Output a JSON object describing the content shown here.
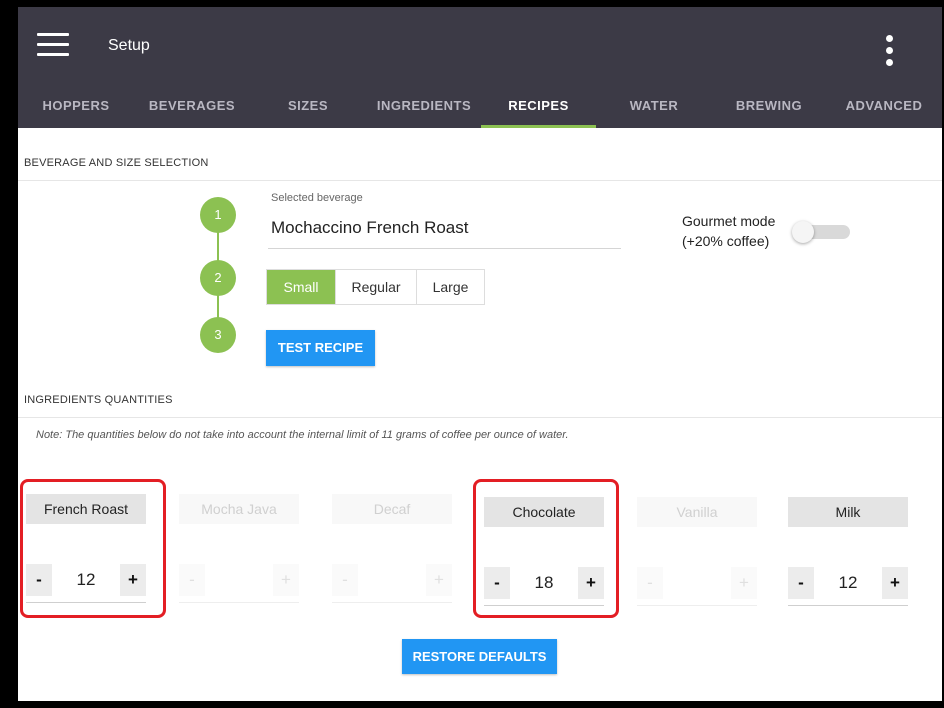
{
  "appbar": {
    "title": "Setup",
    "menu_icon": "hamburger-menu-icon",
    "more_icon": "more-vert-icon",
    "color": "#3c3a46"
  },
  "tabs": [
    {
      "label": "HOPPERS"
    },
    {
      "label": "BEVERAGES"
    },
    {
      "label": "SIZES"
    },
    {
      "label": "INGREDIENTS"
    },
    {
      "label": "RECIPES",
      "active": true
    },
    {
      "label": "WATER"
    },
    {
      "label": "BREWING"
    },
    {
      "label": "ADVANCED"
    }
  ],
  "beverage_section": {
    "heading": "BEVERAGE AND SIZE SELECTION",
    "steps": [
      "1",
      "2",
      "3"
    ],
    "selected_beverage_label": "Selected beverage",
    "selected_beverage": "Mochaccino French Roast",
    "gourmet_mode": {
      "line1": "Gourmet mode",
      "line2": "(+20% coffee)",
      "enabled": false
    },
    "sizes": [
      {
        "label": "Small",
        "active": true
      },
      {
        "label": "Regular",
        "active": false
      },
      {
        "label": "Large",
        "active": false
      }
    ],
    "test_recipe_label": "TEST RECIPE"
  },
  "ingredients_section": {
    "heading": "INGREDIENTS QUANTITIES",
    "note": "Note: The quantities below do not take into account the internal limit of 11 grams of coffee per ounce of water.",
    "minus_label": "-",
    "plus_label": "+",
    "items": [
      {
        "name": "French Roast",
        "enabled": true,
        "qty": "12",
        "highlighted": true
      },
      {
        "name": "Mocha Java",
        "enabled": false,
        "qty": ""
      },
      {
        "name": "Decaf",
        "enabled": false,
        "qty": ""
      },
      {
        "name": "Chocolate",
        "enabled": true,
        "qty": "18",
        "highlighted": true
      },
      {
        "name": "Vanilla",
        "enabled": false,
        "qty": ""
      },
      {
        "name": "Milk",
        "enabled": true,
        "qty": "12"
      }
    ],
    "restore_defaults_label": "RESTORE DEFAULTS"
  },
  "colors": {
    "accent_green": "#8cc152",
    "button_blue": "#2196f3",
    "highlight_red": "#e31e24"
  }
}
